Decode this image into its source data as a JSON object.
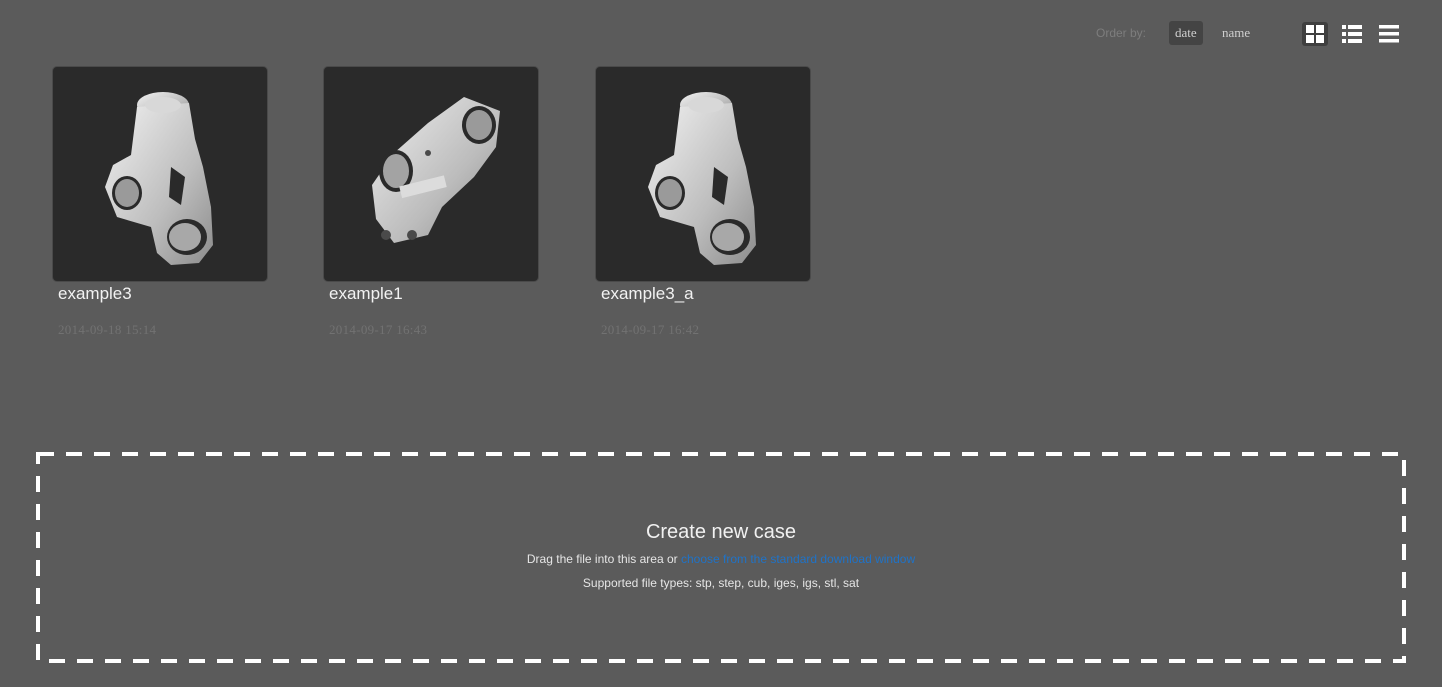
{
  "toolbar": {
    "order_label": "Order by:",
    "order_options": [
      "date",
      "name"
    ],
    "active_order": "date",
    "view_modes": [
      "grid-view-icon",
      "list-view-icon",
      "rows-view-icon"
    ],
    "active_view": "grid-view-icon"
  },
  "cases": [
    {
      "name": "example3",
      "date": "2014-09-18 15:14",
      "thumbnail": "part-model-a"
    },
    {
      "name": "example1",
      "date": "2014-09-17 16:43",
      "thumbnail": "part-model-b"
    },
    {
      "name": "example3_a",
      "date": "2014-09-17 16:42",
      "thumbnail": "part-model-a"
    }
  ],
  "dropzone": {
    "title": "Create new case",
    "line1_prefix": "Drag the file into this area or ",
    "line1_link": "choose from the standard download window",
    "line2": "Supported file types: stp, step, cub, iges, igs, stl, sat"
  },
  "colors": {
    "background": "#5b5b5b",
    "thumb_background": "#2a2a2a",
    "link": "#1f73c8",
    "active_button": "#444444"
  }
}
